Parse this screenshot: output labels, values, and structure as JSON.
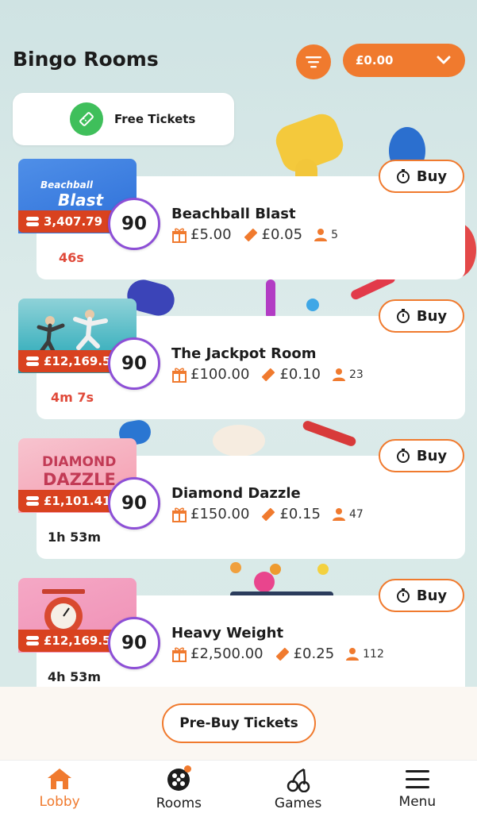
{
  "header": {
    "title": "Bingo Rooms",
    "balance": "£0.00"
  },
  "free_tickets": {
    "label": "Free Tickets"
  },
  "rooms": [
    {
      "thumb_title": [
        "Beachball",
        "Blast"
      ],
      "jackpot": "3,407.79",
      "ball": "90",
      "name": "Beachball Blast",
      "prize": "£5.00",
      "ticket_price": "£0.05",
      "players": "5",
      "timer": "46s",
      "buy_label": "Buy"
    },
    {
      "jackpot": "£12,169.5",
      "ball": "90",
      "name": "The Jackpot Room",
      "prize": "£100.00",
      "ticket_price": "£0.10",
      "players": "23",
      "timer": "4m 7s",
      "buy_label": "Buy"
    },
    {
      "thumb_title": [
        "DIAMOND",
        "DAZZLE"
      ],
      "jackpot": "£1,101.41",
      "ball": "90",
      "name": "Diamond Dazzle",
      "prize": "£150.00",
      "ticket_price": "£0.15",
      "players": "47",
      "timer": "1h 53m",
      "buy_label": "Buy"
    },
    {
      "jackpot": "£12,169.5",
      "ball": "90",
      "name": "Heavy Weight",
      "prize": "£2,500.00",
      "ticket_price": "£0.25",
      "players": "112",
      "timer": "4h 53m",
      "buy_label": "Buy"
    }
  ],
  "prebuy": {
    "label": "Pre-Buy Tickets"
  },
  "nav": [
    {
      "label": "Lobby",
      "icon": "home-icon",
      "active": true
    },
    {
      "label": "Rooms",
      "icon": "bingo-balls-icon",
      "active": false
    },
    {
      "label": "Games",
      "icon": "cherries-icon",
      "active": false
    },
    {
      "label": "Menu",
      "icon": "hamburger-icon",
      "active": false
    }
  ],
  "colors": {
    "accent": "#f07a2e",
    "jackpot_red": "#d9421f",
    "ball_border": "#8d4fd6",
    "free_ticket_green": "#3fbf5b"
  }
}
